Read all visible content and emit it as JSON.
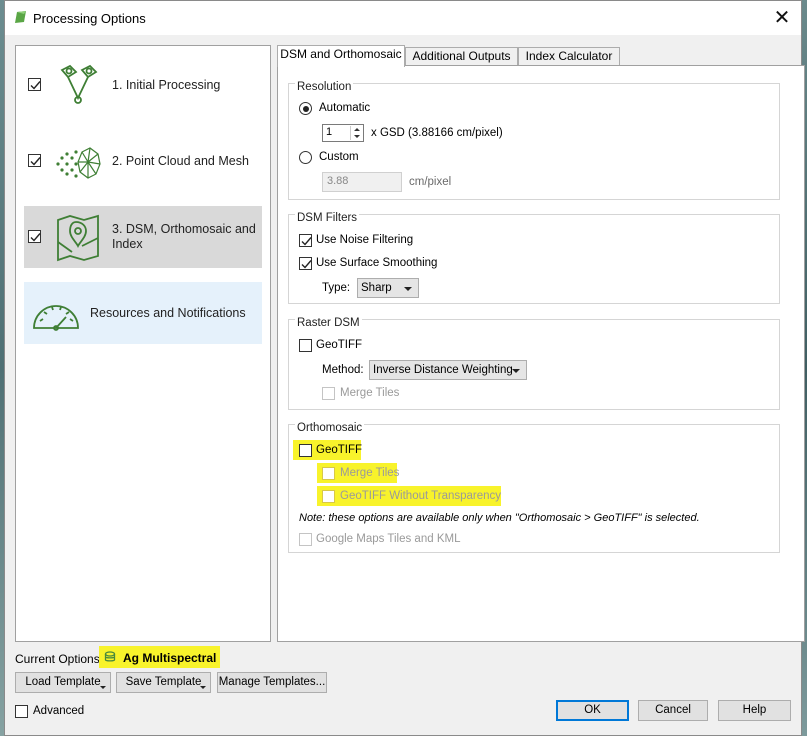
{
  "window": {
    "title": "Processing Options",
    "close": "✕"
  },
  "steps": [
    {
      "label": "1. Initial Processing",
      "checked": true,
      "icon": "initial-processing-icon"
    },
    {
      "label": "2. Point Cloud and Mesh",
      "checked": true,
      "icon": "point-cloud-icon"
    },
    {
      "label": "3. DSM, Orthomosaic and Index",
      "checked": true,
      "icon": "map-pin-icon"
    },
    {
      "label": "Resources and Notifications",
      "icon": "gauge-icon"
    }
  ],
  "tabs": [
    "DSM and Orthomosaic",
    "Additional Outputs",
    "Index Calculator"
  ],
  "resolution": {
    "title": "Resolution",
    "automatic_label": "Automatic",
    "gsd_value": "1",
    "gsd_label": "x GSD (3.88166 cm/pixel)",
    "custom_label": "Custom",
    "custom_value": "3.88",
    "custom_unit": "cm/pixel"
  },
  "dsm_filters": {
    "title": "DSM Filters",
    "noise_label": "Use Noise Filtering",
    "smoothing_label": "Use Surface Smoothing",
    "type_label": "Type:",
    "type_value": "Sharp"
  },
  "raster_dsm": {
    "title": "Raster DSM",
    "geotiff_label": "GeoTIFF",
    "method_label": "Method:",
    "method_value": "Inverse Distance Weighting",
    "merge_label": "Merge Tiles"
  },
  "orthomosaic": {
    "title": "Orthomosaic",
    "geotiff_label": "GeoTIFF",
    "merge_label": "Merge Tiles",
    "no_transparency_label": "GeoTIFF Without Transparency",
    "note": "Note: these options are available only when \"Orthomosaic > GeoTIFF\" is selected.",
    "google_label": "Google Maps Tiles and KML"
  },
  "footer": {
    "current_options_label": "Current Options:",
    "current_options_value": "Ag Multispectral",
    "load_template": "Load Template",
    "save_template": "Save Template",
    "manage_templates": "Manage Templates...",
    "advanced": "Advanced",
    "ok": "OK",
    "cancel": "Cancel",
    "help": "Help"
  },
  "colors": {
    "accent": "#4a8a3c",
    "highlight": "#f8f32b",
    "default_button": "#0078d7"
  }
}
